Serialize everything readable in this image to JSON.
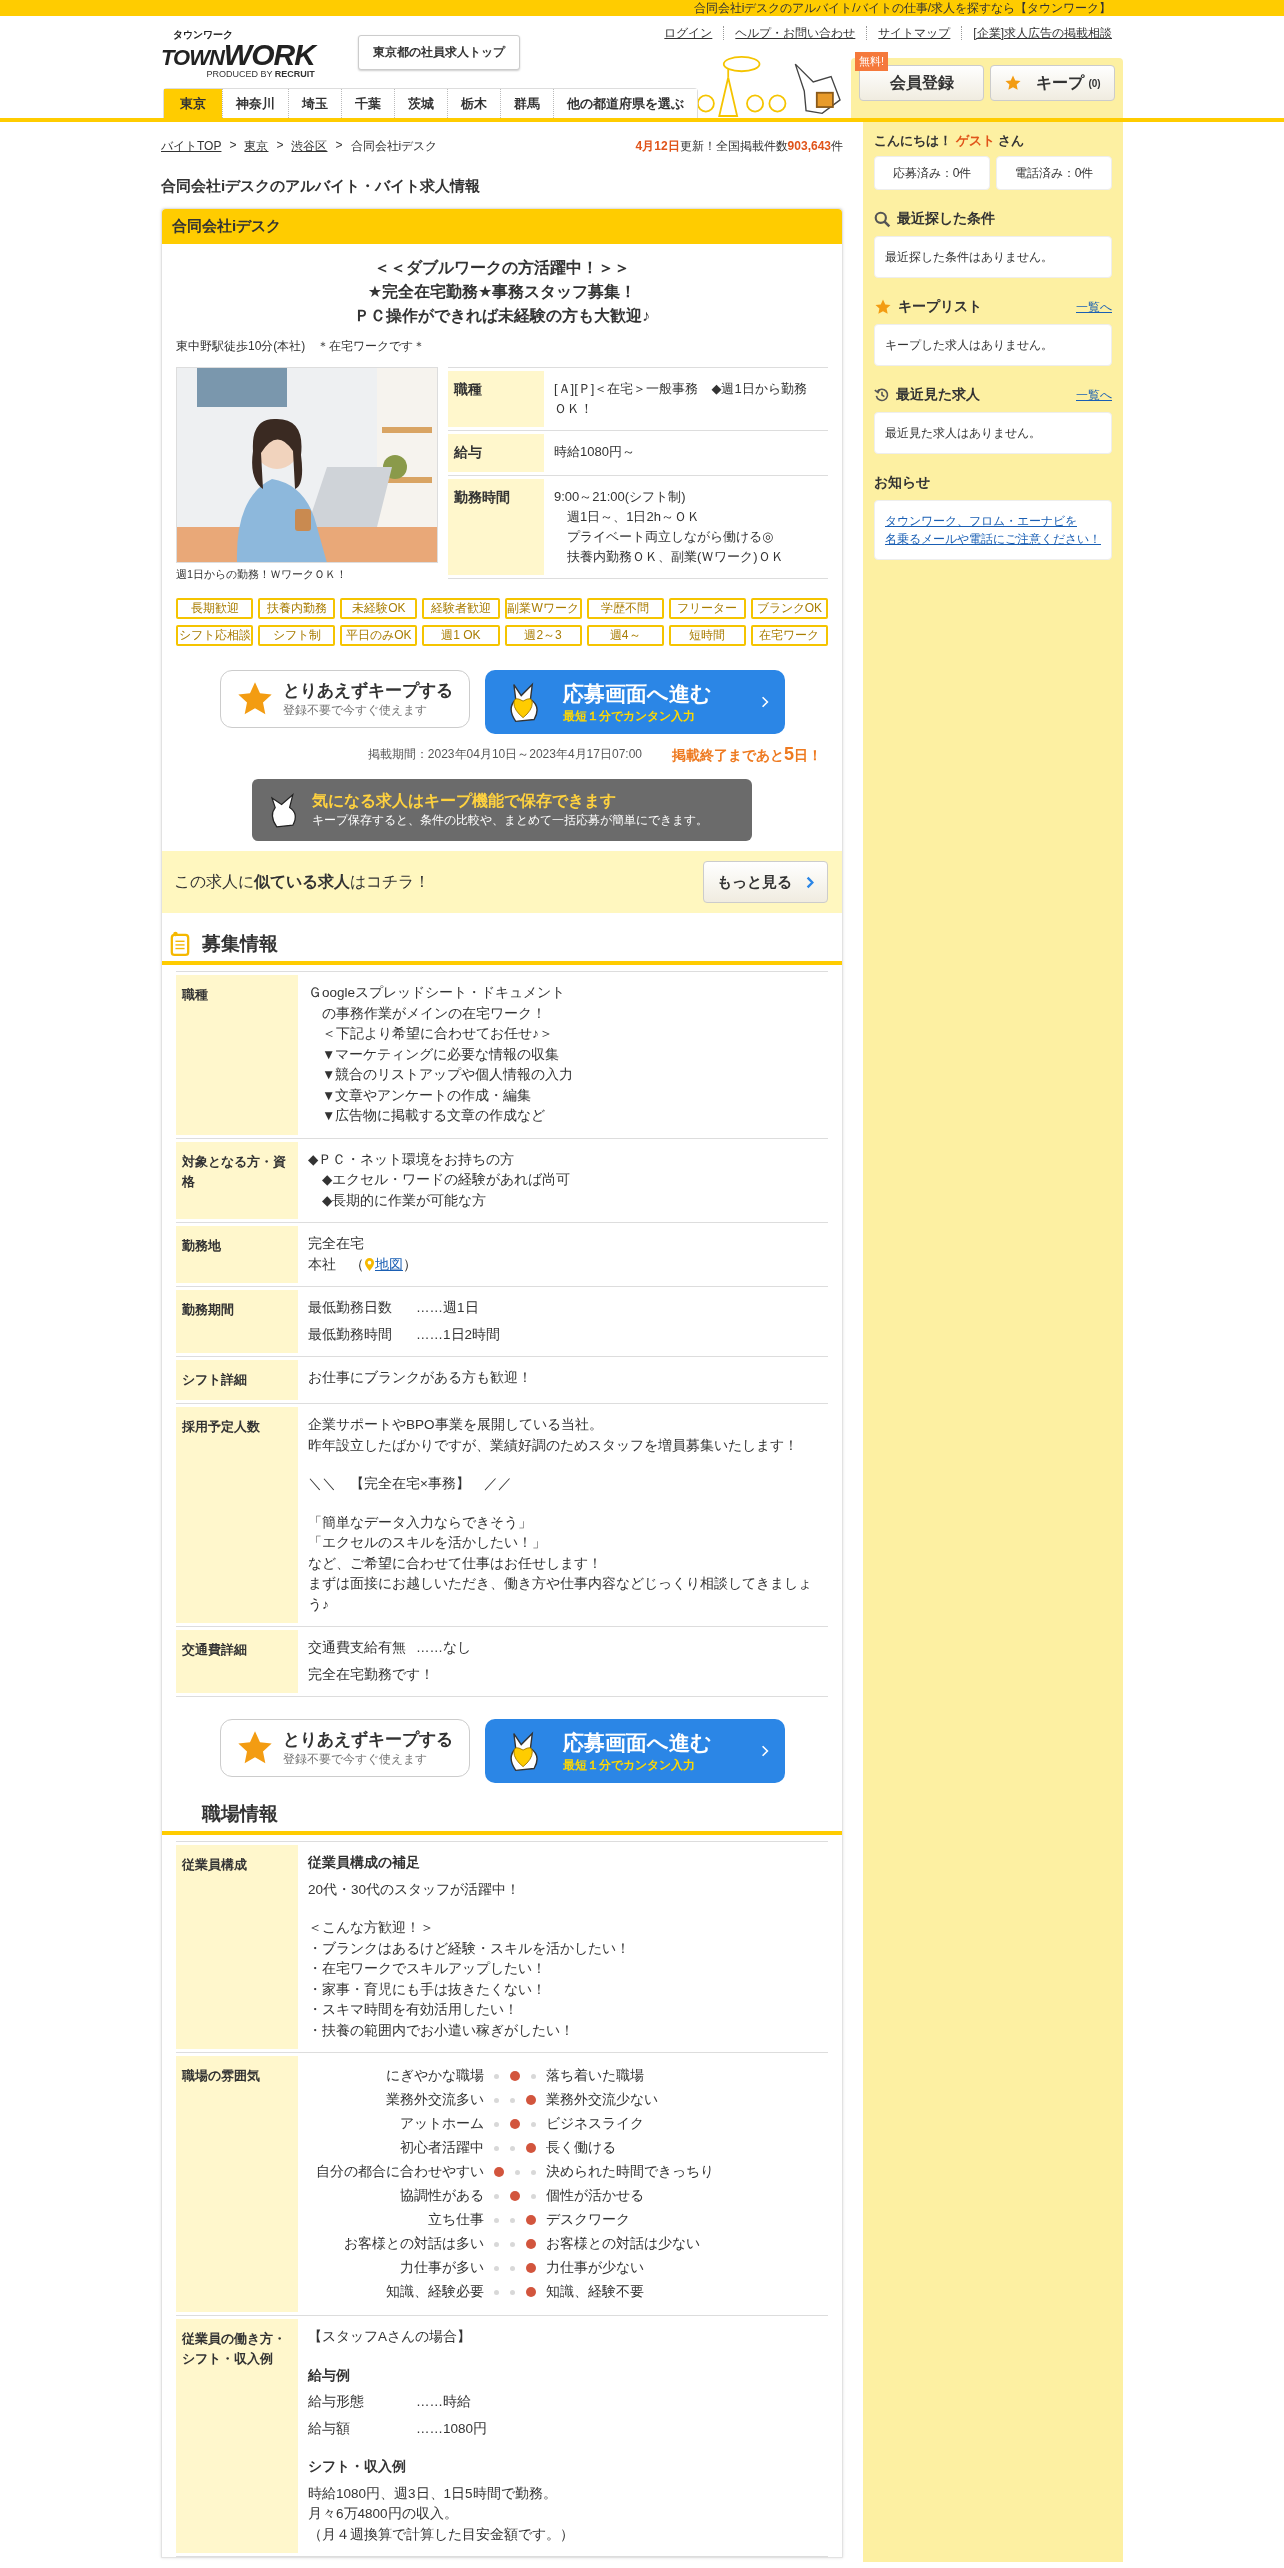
{
  "top_bar": {
    "text": "合同会社iデスクのアルバイト/バイトの仕事/求人を探すなら【タウンワーク】"
  },
  "logo": {
    "kana": "タウンワーク",
    "word_1": "TOWN",
    "word_2": "WORK",
    "produced_by": "PRODUCED BY",
    "brand": "RECRUIT"
  },
  "header_button": "東京都の社員求人トップ",
  "header_links": [
    "ログイン",
    "ヘルプ・お問い合わせ",
    "サイトマップ",
    "[企業]求人広告の掲載相談"
  ],
  "member_button": {
    "badge": "無料!",
    "label": "会員登録"
  },
  "keep_button": {
    "label": "キープ",
    "count": "(0)"
  },
  "prefecture_tabs": [
    {
      "label": "東京",
      "selected": true
    },
    {
      "label": "神奈川",
      "selected": false
    },
    {
      "label": "埼玉",
      "selected": false
    },
    {
      "label": "千葉",
      "selected": false
    },
    {
      "label": "茨城",
      "selected": false
    },
    {
      "label": "栃木",
      "selected": false
    },
    {
      "label": "群馬",
      "selected": false
    },
    {
      "label": "他の都道府県を選ぶ",
      "selected": false
    }
  ],
  "breadcrumb": {
    "separator": ">",
    "items": [
      {
        "label": "バイトTOP",
        "link": true
      },
      {
        "label": "東京",
        "link": true
      },
      {
        "label": "渋谷区",
        "link": true
      },
      {
        "label": "合同会社iデスク",
        "link": false
      }
    ]
  },
  "update_info": {
    "date": "4月12日",
    "middle": "更新！全国掲載件数",
    "count": "903,643",
    "suffix": "件"
  },
  "page_title": "合同会社iデスクのアルバイト・バイト求人情報",
  "job": {
    "company": "合同会社iデスク",
    "catch": [
      "＜＜ダブルワークの方活躍中！＞＞",
      "★完全在宅勤務★事務スタッフ募集！",
      "ＰＣ操作ができれば未経験の方も大歓迎♪"
    ],
    "access": "東中野駅徒歩10分(本社)　＊在宅ワークです＊",
    "photo": {
      "kind": "picture",
      "caption": "週1日からの勤務！ＷワークＯＫ！"
    },
    "specs": [
      {
        "label": "職種",
        "lines": [
          "[Ａ][Ｐ]＜在宅＞一般事務　◆週1日から勤務ＯＫ！"
        ]
      },
      {
        "label": "給与",
        "lines": [
          "時給1080円～"
        ]
      },
      {
        "label": "勤務時間",
        "lines": [
          "9:00～21:00(シフト制)",
          "　週1日～、1日2h～ＯＫ",
          "　プライベート両立しながら働ける◎",
          "　扶養内勤務ＯＫ、副業(Ｗワーク)ＯＫ"
        ]
      }
    ],
    "tags": [
      "長期歓迎",
      "扶養内勤務",
      "未経験OK",
      "経験者歓迎",
      "副業Wワーク",
      "学歴不問",
      "フリーター",
      "ブランクOK",
      "シフト応相談",
      "シフト制",
      "平日のみOK",
      "週1 OK",
      "週2～3",
      "週4～",
      "短時間",
      "在宅ワーク"
    ],
    "actions_top": {
      "keep": {
        "title": "とりあえずキープする",
        "subtitle": "登録不要で今すぐ使えます"
      },
      "apply": {
        "title": "応募画面へ進む",
        "subtitle": "最短１分でカンタン入力"
      }
    },
    "period": "掲載期間：2023年04月10日～2023年4月17日07:00",
    "deadline": "掲載終了まであと**5**日！",
    "keep_banner": {
      "title": "気になる求人はキープ機能で保存できます",
      "text": "キープ保存すると、条件の比較や、まとめて一括応募が簡単にできます。"
    },
    "similar": {
      "text": "この求人に**似ている求人**はコチラ！",
      "button": "もっと見る"
    }
  },
  "sections": [
    {
      "title": "募集情報",
      "has_icon": true,
      "rows": [
        {
          "label": "職種",
          "blocks": [
            {
              "kind": "text",
              "lines": [
                "Ｇoogleスプレッドシート・ドキュメント",
                "　の事務作業がメインの在宅ワーク！",
                "　＜下記より希望に合わせてお任せ♪＞",
                "　▼マーケティングに必要な情報の収集",
                "　▼競合のリストアップや個人情報の入力",
                "　▼文章やアンケートの作成・編集",
                "　▼広告物に掲載する文章の作成など"
              ]
            }
          ]
        },
        {
          "label": "対象となる方・資格",
          "blocks": [
            {
              "kind": "text",
              "lines": [
                "◆ＰＣ・ネット環境をお持ちの方",
                "　◆エクセル・ワードの経験があれば尚可",
                "　◆長期的に作業が可能な方"
              ]
            }
          ]
        },
        {
          "label": "勤務地",
          "blocks": [
            {
              "kind": "text",
              "lines": [
                "完全在宅"
              ]
            },
            {
              "kind": "map",
              "prefix": "本社　（",
              "link": "地図",
              "suffix": "）"
            }
          ]
        },
        {
          "label": "勤務期間",
          "blocks": [
            {
              "kind": "pair",
              "label": "最低勤務日数",
              "value": "……週1日"
            },
            {
              "kind": "pair",
              "label": "最低勤務時間",
              "value": "……1日2時間"
            }
          ]
        },
        {
          "label": "シフト詳細",
          "blocks": [
            {
              "kind": "text",
              "lines": [
                "お仕事にブランクがある方も歓迎！"
              ]
            }
          ]
        },
        {
          "label": "採用予定人数",
          "blocks": [
            {
              "kind": "text",
              "lines": [
                "企業サポートやBPO事業を展開している当社。",
                "昨年設立したばかりですが、業績好調のためスタッフを増員募集いたします！"
              ]
            },
            {
              "kind": "text",
              "lines": [
                "＼＼　【完全在宅×事務】　／／"
              ]
            },
            {
              "kind": "text",
              "lines": [
                "「簡単なデータ入力ならできそう」",
                "「エクセルのスキルを活かしたい！」",
                "など、ご希望に合わせて仕事はお任せします！",
                "まずは面接にお越しいただき、働き方や仕事内容などじっくり相談してきましょう♪"
              ]
            }
          ]
        },
        {
          "label": "交通費詳細",
          "blocks": [
            {
              "kind": "pair",
              "label": "交通費支給有無",
              "value": "……なし"
            },
            {
              "kind": "text",
              "lines": [
                "完全在宅勤務です！"
              ]
            }
          ]
        }
      ],
      "actions": {
        "keep": {
          "title": "とりあえずキープする",
          "subtitle": "登録不要で今すぐ使えます"
        },
        "apply": {
          "title": "応募画面へ進む",
          "subtitle": "最短１分でカンタン入力"
        }
      }
    },
    {
      "title": "職場情報",
      "has_icon": false,
      "rows": [
        {
          "label": "従業員構成",
          "blocks": [
            {
              "kind": "heading",
              "text": "従業員構成の補足"
            },
            {
              "kind": "text",
              "lines": [
                "20代・30代のスタッフが活躍中！"
              ]
            },
            {
              "kind": "text",
              "lines": [
                "＜こんな方歓迎！＞",
                "・ブランクはあるけど経験・スキルを活かしたい！",
                "・在宅ワークでスキルアップしたい！",
                "・家事・育児にも手は抜きたくない！",
                "・スキマ時間を有効活用したい！",
                "・扶養の範囲内でお小遣い稼ぎがしたい！"
              ]
            }
          ]
        },
        {
          "label": "職場の雰囲気",
          "blocks": [
            {
              "kind": "scale",
              "left": "にぎやかな職場",
              "right": "落ち着いた職場",
              "dots": [
                {
                  "selected": false
                },
                {
                  "selected": true
                },
                {
                  "selected": false
                }
              ]
            },
            {
              "kind": "scale",
              "left": "業務外交流多い",
              "right": "業務外交流少ない",
              "dots": [
                {
                  "selected": false
                },
                {
                  "selected": false
                },
                {
                  "selected": true
                }
              ]
            },
            {
              "kind": "scale",
              "left": "アットホーム",
              "right": "ビジネスライク",
              "dots": [
                {
                  "selected": false
                },
                {
                  "selected": true
                },
                {
                  "selected": false
                }
              ]
            },
            {
              "kind": "scale",
              "left": "初心者活躍中",
              "right": "長く働ける",
              "dots": [
                {
                  "selected": false
                },
                {
                  "selected": false
                },
                {
                  "selected": true
                }
              ]
            },
            {
              "kind": "scale",
              "left": "自分の都合に合わせやすい",
              "right": "決められた時間できっちり",
              "dots": [
                {
                  "selected": true
                },
                {
                  "selected": false
                },
                {
                  "selected": false
                }
              ]
            },
            {
              "kind": "scale",
              "left": "協調性がある",
              "right": "個性が活かせる",
              "dots": [
                {
                  "selected": false
                },
                {
                  "selected": true
                },
                {
                  "selected": false
                }
              ]
            },
            {
              "kind": "scale",
              "left": "立ち仕事",
              "right": "デスクワーク",
              "dots": [
                {
                  "selected": false
                },
                {
                  "selected": false
                },
                {
                  "selected": true
                }
              ]
            },
            {
              "kind": "scale",
              "left": "お客様との対話は多い",
              "right": "お客様との対話は少ない",
              "dots": [
                {
                  "selected": false
                },
                {
                  "selected": false
                },
                {
                  "selected": true
                }
              ]
            },
            {
              "kind": "scale",
              "left": "力仕事が多い",
              "right": "力仕事が少ない",
              "dots": [
                {
                  "selected": false
                },
                {
                  "selected": false
                },
                {
                  "selected": true
                }
              ]
            },
            {
              "kind": "scale",
              "left": "知識、経験必要",
              "right": "知識、経験不要",
              "dots": [
                {
                  "selected": false
                },
                {
                  "selected": false
                },
                {
                  "selected": true
                }
              ]
            }
          ]
        },
        {
          "label": "従業員の働き方・シフト・収入例",
          "blocks": [
            {
              "kind": "text",
              "lines": [
                "【スタッフAさんの場合】"
              ]
            },
            {
              "kind": "heading",
              "text": "給与例"
            },
            {
              "kind": "pair",
              "label": "給与形態",
              "value": "……時給"
            },
            {
              "kind": "pair",
              "label": "給与額",
              "value": "……1080円"
            },
            {
              "kind": "heading",
              "text": "シフト・収入例"
            },
            {
              "kind": "text",
              "lines": [
                "時給1080円、週3日、1日5時間で勤務。",
                "月々6万4800円の収入。",
                "（月４週換算で計算した目安金額です。）"
              ]
            }
          ]
        }
      ]
    }
  ],
  "sidebar": {
    "greeting": {
      "before": "こんにちは！",
      "name": "ゲスト",
      "after": "さん"
    },
    "counters": [
      "応募済み：0件",
      "電話済み：0件"
    ],
    "panels": [
      {
        "kind": "search",
        "title": "最近探した条件",
        "text": "最近探した条件はありません。"
      },
      {
        "kind": "star",
        "title": "キープリスト",
        "link": "一覧へ",
        "text": "キープした求人はありません。"
      },
      {
        "kind": "history",
        "title": "最近見た求人",
        "link": "一覧へ",
        "text": "最近見た求人はありません。"
      }
    ],
    "notice": {
      "title": "お知らせ",
      "link_lines": [
        "タウンワーク、フロム・エーナビを",
        "名乗るメールや電話にご注意ください！"
      ]
    }
  }
}
